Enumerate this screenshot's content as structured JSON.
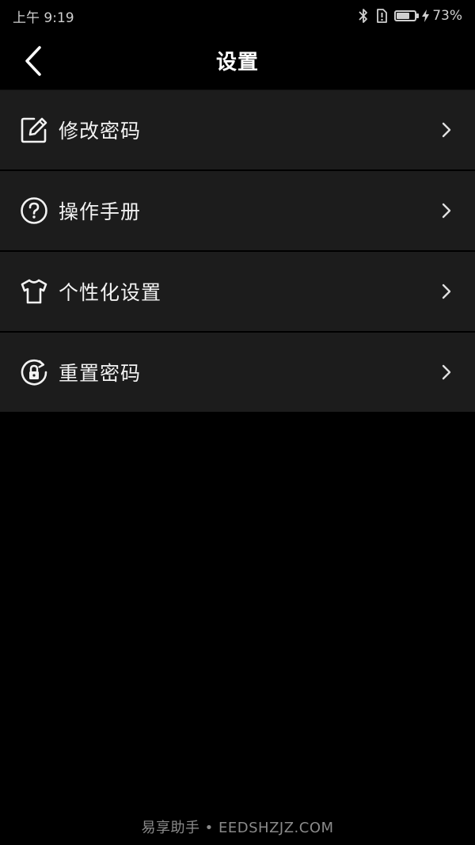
{
  "status_bar": {
    "time": "上午 9:19",
    "battery_percent": "73%",
    "battery_level": 0.73,
    "icons": [
      "bluetooth-icon",
      "alert-sim-icon",
      "battery-icon",
      "charging-bolt-icon"
    ]
  },
  "header": {
    "title": "设置",
    "back_icon": "chevron-left-icon"
  },
  "menu": {
    "items": [
      {
        "label": "修改密码",
        "icon": "edit-icon"
      },
      {
        "label": "操作手册",
        "icon": "help-circle-icon"
      },
      {
        "label": "个性化设置",
        "icon": "tshirt-icon"
      },
      {
        "label": "重置密码",
        "icon": "lock-reset-icon"
      }
    ],
    "chevron_icon": "chevron-right-icon"
  },
  "watermark": {
    "text": "易享助手 • EEDSHZJZ.COM"
  },
  "colors": {
    "background": "#000000",
    "row_background": "#1c1c1c",
    "text": "#f2f2f2",
    "muted_text": "#8a8a8a"
  }
}
